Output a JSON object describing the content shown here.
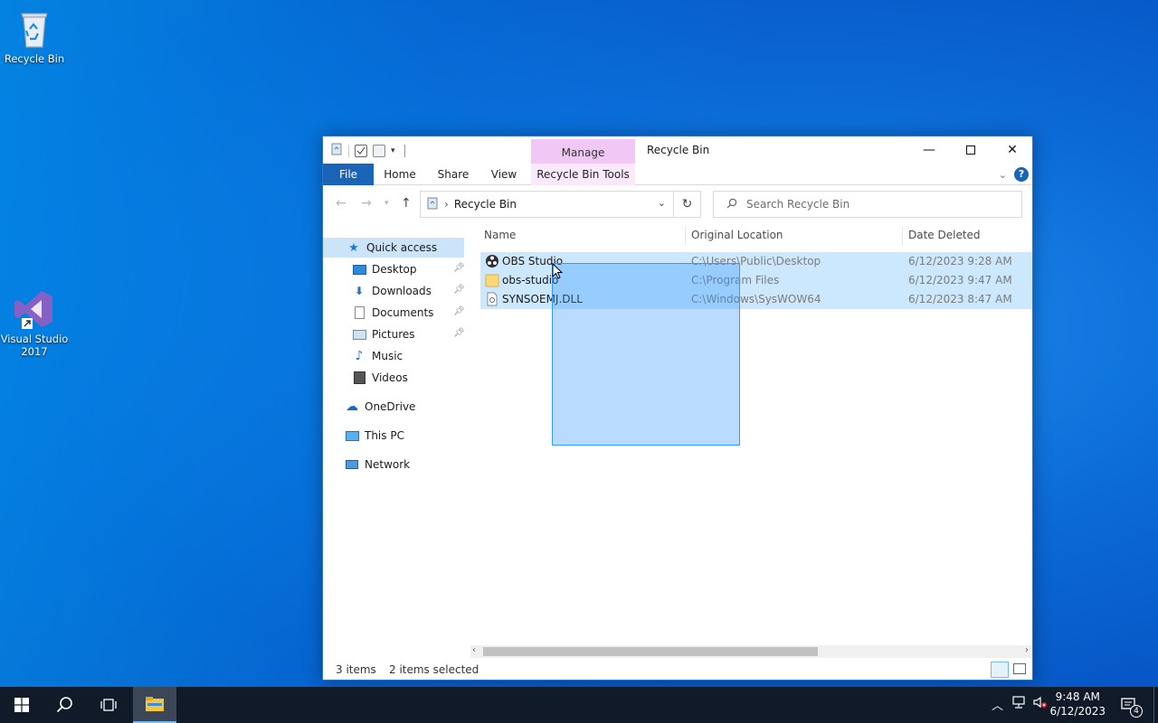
{
  "desktop": {
    "icons": [
      {
        "label": "Recycle Bin"
      },
      {
        "label": "Visual Studio 2017"
      }
    ]
  },
  "window": {
    "title": "Recycle Bin",
    "manage_tab": "Manage",
    "ribbon_tabs": [
      "File",
      "Home",
      "Share",
      "View",
      "Recycle Bin Tools"
    ],
    "address_path": "Recycle Bin",
    "search_placeholder": "Search Recycle Bin",
    "sidebar": {
      "quick_access": "Quick access",
      "pinned": [
        "Desktop",
        "Downloads",
        "Documents",
        "Pictures"
      ],
      "unpinned": [
        "Music",
        "Videos"
      ],
      "onedrive": "OneDrive",
      "this_pc": "This PC",
      "network": "Network"
    },
    "columns": [
      "Name",
      "Original Location",
      "Date Deleted"
    ],
    "files": [
      {
        "name": "OBS Studio",
        "location": "C:\\Users\\Public\\Desktop",
        "date": "6/12/2023 9:28 AM",
        "icon": "obs-icon"
      },
      {
        "name": "obs-studio",
        "location": "C:\\Program Files",
        "date": "6/12/2023 9:47 AM",
        "icon": "folder-icon"
      },
      {
        "name": "SYNSOEMJ.DLL",
        "location": "C:\\Windows\\SysWOW64",
        "date": "6/12/2023 8:47 AM",
        "icon": "dll-file-icon"
      }
    ],
    "status": {
      "count": "3 items",
      "selected": "2 items selected"
    }
  },
  "taskbar": {
    "time": "9:48 AM",
    "date": "6/12/2023",
    "notification_count": "4"
  },
  "colors": {
    "accent": "#1a64b8",
    "selection": "#cce8ff",
    "manage": "#f1c8f5",
    "taskbar": "#101a28"
  }
}
